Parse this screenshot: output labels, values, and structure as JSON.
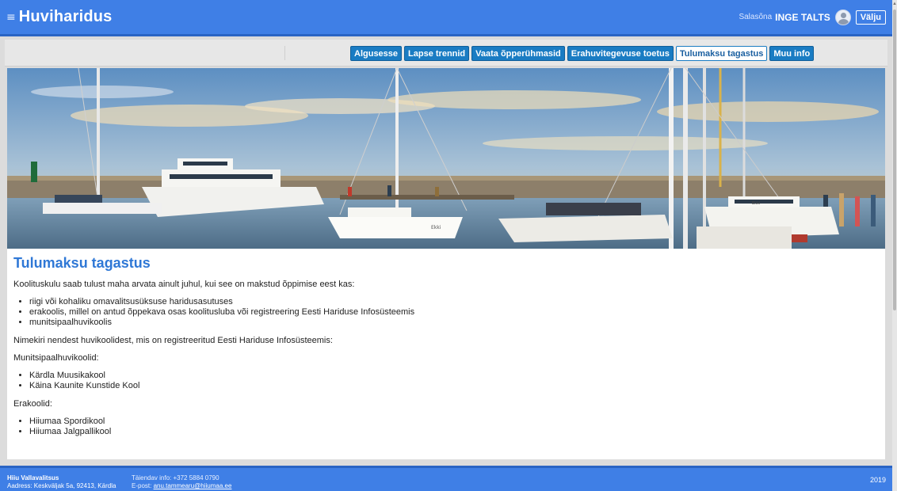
{
  "header": {
    "menu_icon": "menu-icon",
    "brand": "Huviharidus",
    "password_label": "Salasõna",
    "user_name": "INGE TALTS",
    "logout_label": "Välju"
  },
  "nav": {
    "items": [
      {
        "label": "Algusesse"
      },
      {
        "label": "Lapse trennid"
      },
      {
        "label": "Vaata õpperühmasid"
      },
      {
        "label": "Erahuvitegevuse toetus"
      },
      {
        "label": "Tulumaksu tagastus"
      },
      {
        "label": "Muu info"
      }
    ],
    "active_index": 4
  },
  "hero": {
    "boat_name_1": "Ekki",
    "boat_name_2": "Ekki"
  },
  "content": {
    "title": "Tulumaksu tagastus",
    "intro": "Koolituskulu saab tulust maha arvata ainult juhul, kui see on makstud õppimise eest kas:",
    "conditions": [
      "riigi või kohaliku omavalitsusüksuse haridusasutuses",
      "erakoolis, millel on antud õppekava osas koolitusluba või registreering Eesti Hariduse Infosüsteemis",
      "munitsipaalhuvikoolis"
    ],
    "list_intro": "Nimekiri nendest huvikoolidest, mis on registreeritud Eesti Hariduse Infosüsteemis:",
    "municipal_heading": "Munitsipaalhuvikoolid:",
    "municipal_schools": [
      "Kärdla Muusikakool",
      "Käina Kaunite Kunstide Kool"
    ],
    "private_heading": "Erakoolid:",
    "private_schools": [
      "Hiiumaa Spordikool",
      "Hiiumaa Jalgpallikool"
    ]
  },
  "footer": {
    "org": "Hiiu Vallavalitsus",
    "address": "Aadress: Keskväljak 5a, 92413, Kärdla",
    "info": "Täiendav info: +372 5884 0790",
    "email_label": "E-post:",
    "email": "anu.tammearu@hiiumaa.ee",
    "year": "2019"
  },
  "colors": {
    "header_blue": "#3f7fe6",
    "nav_button": "#1a7cc3",
    "title_blue": "#2f78d6"
  }
}
